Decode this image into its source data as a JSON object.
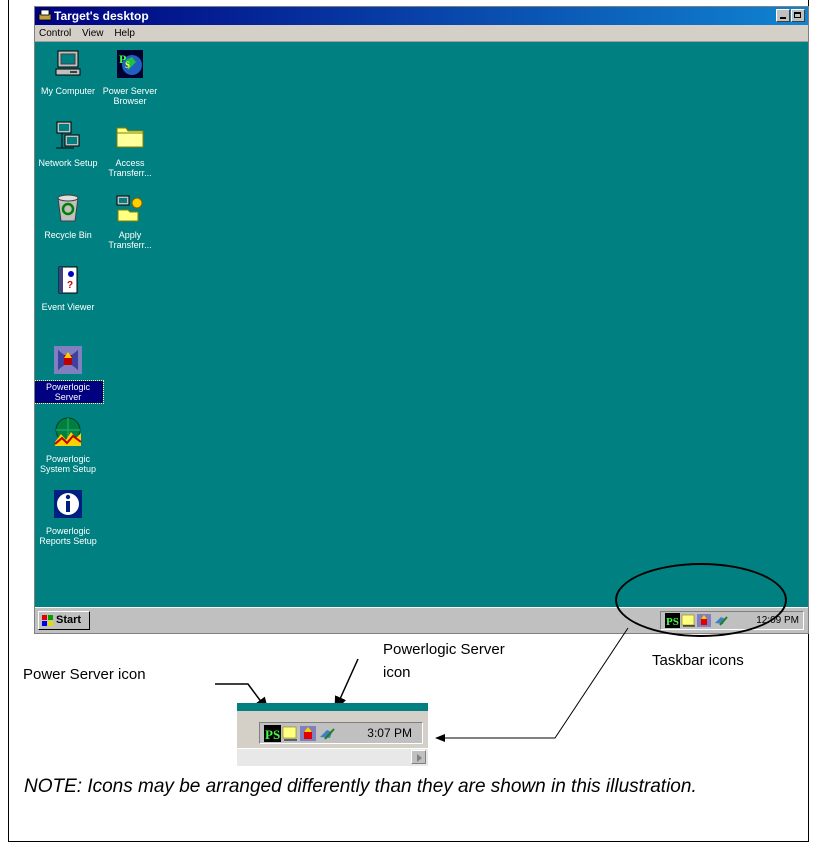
{
  "window": {
    "title": "Target's desktop",
    "menus": [
      "Control",
      "View",
      "Help"
    ]
  },
  "desktop": {
    "icons": [
      {
        "label": "My Computer",
        "icon": "my-computer-icon"
      },
      {
        "label": "Power Server Browser",
        "icon": "power-server-browser-icon"
      },
      {
        "label": "Network Setup",
        "icon": "network-setup-icon"
      },
      {
        "label": "Access Transferr...",
        "icon": "folder-icon"
      },
      {
        "label": "Recycle Bin",
        "icon": "recycle-bin-icon"
      },
      {
        "label": "Apply Transferr...",
        "icon": "apply-transfer-icon"
      },
      {
        "label": "Event Viewer",
        "icon": "event-viewer-icon"
      },
      {
        "label": "Powerlogic Server",
        "icon": "powerlogic-server-icon",
        "selected": true
      },
      {
        "label": "Powerlogic System Setup",
        "icon": "powerlogic-system-setup-icon"
      },
      {
        "label": "Powerlogic Reports Setup",
        "icon": "powerlogic-reports-setup-icon"
      }
    ],
    "background_color": "#008080"
  },
  "taskbar": {
    "start_label": "Start",
    "clock": "12:09 PM"
  },
  "annotations": {
    "power_server_icon": "Power Server icon",
    "powerlogic_server_icon_line1": "Powerlogic Server",
    "powerlogic_server_icon_line2": "icon",
    "taskbar_icons": "Taskbar icons",
    "inset_clock": "3:07 PM",
    "note": "NOTE: Icons may be arranged differently than they are shown in this illustration."
  }
}
